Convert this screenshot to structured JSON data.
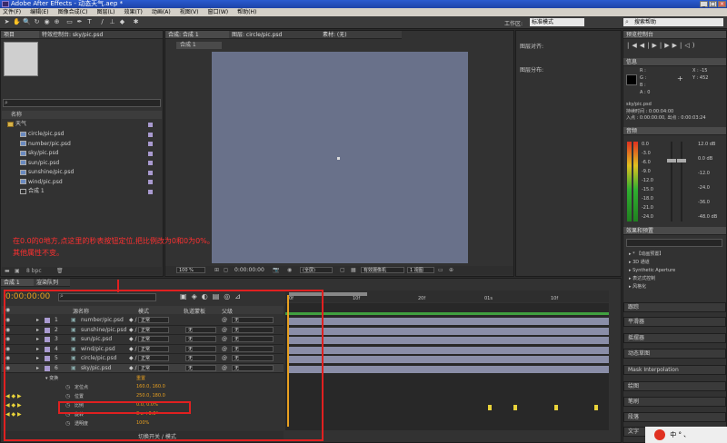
{
  "window": {
    "title": "Adobe After Effects - 动态天气.aep *"
  },
  "menu": [
    "文件(F)",
    "编辑(E)",
    "图像合成(C)",
    "图层(L)",
    "效果(T)",
    "动画(A)",
    "视图(V)",
    "窗口(W)",
    "帮助(H)"
  ],
  "toolbar": {
    "workspace_label": "工作区:",
    "workspace_value": "标准模式",
    "search_placeholder": "搜索帮助"
  },
  "project": {
    "tab": "项目",
    "effects_tab": "特效控制台: sky/pic.psd",
    "search": "",
    "col_name": "名称",
    "folder": "天气",
    "files": [
      "circle/pic.psd",
      "number/pic.psd",
      "sky/pic.psd",
      "sun/pic.psd",
      "sunshine/pic.psd",
      "wind/pic.psd"
    ],
    "comp": "合成 1",
    "bpc": "8 bpc"
  },
  "composition": {
    "tab": "合成: 合成 1",
    "layer_tab": "图层: circle/pic.psd",
    "footage_tab": "素材: (无)",
    "subtab": "合成 1",
    "zoom": "100 %",
    "time": "0:00:00:00",
    "quality": "(全屏)",
    "camera": "有效摄像机",
    "views": "1 视图"
  },
  "info_panel": {
    "align_title": "图层对齐:",
    "distribute_title": "图层分布:"
  },
  "preview": {
    "tab": "预览控制台"
  },
  "info": {
    "tab": "信息",
    "r": "R :",
    "g": "G :",
    "b": "B :",
    "a": "A : 0",
    "x": "X : -15",
    "y": "Y : 452",
    "name": "sky/pic.psd",
    "duration": "持续时间 : 0:00:04:00",
    "in": "入点 : 0:00:00:00, 出点 : 0:00:03:24"
  },
  "audio": {
    "tab": "音频",
    "left_scale": [
      "0.0",
      "-3.0",
      "-6.0",
      "-9.0",
      "-12.0",
      "-15.0",
      "-18.0",
      "-21.0",
      "-24.0"
    ],
    "right_scale": [
      "12.0 dB",
      "0.0 dB",
      "-12.0",
      "-24.0",
      "-36.0",
      "-48.0 dB"
    ]
  },
  "effects": {
    "tab": "效果和预置",
    "search": "",
    "items": [
      "* 【动画预置】",
      "3D 通道",
      "Synthetic Aperture",
      "表达式控制",
      "风格化"
    ]
  },
  "right_tabs": [
    "跟踪",
    "平滑器",
    "摇摆器",
    "动态草图",
    "Mask Interpolation",
    "绘图",
    "笔刷",
    "段落",
    "文字"
  ],
  "annotation": {
    "line1": "在0.0的0地方,点这里的秒表按钮定位,把比例改为0和0为0%。",
    "line2": "其他属性不变。"
  },
  "timeline": {
    "tab": "合成 1",
    "render_tab": "渲染队列",
    "time": "0:00:00:00",
    "cols": {
      "name": "源名称",
      "mode": "模式",
      "trkmat": "轨道蒙板",
      "parent": "父级"
    },
    "ruler": [
      "0f",
      "10f",
      "20f",
      "01s",
      "10f"
    ],
    "layers": [
      {
        "num": "1",
        "name": "number/pic.psd",
        "mode": "正常",
        "trk": "",
        "parent": "无",
        "color": "#a99ad0"
      },
      {
        "num": "2",
        "name": "sunshine/pic.psd",
        "mode": "正常",
        "trk": "无",
        "parent": "无",
        "color": "#a99ad0"
      },
      {
        "num": "3",
        "name": "sun/pic.psd",
        "mode": "正常",
        "trk": "无",
        "parent": "无",
        "color": "#a99ad0"
      },
      {
        "num": "4",
        "name": "wind/pic.psd",
        "mode": "正常",
        "trk": "无",
        "parent": "无",
        "color": "#a99ad0"
      },
      {
        "num": "5",
        "name": "circle/pic.psd",
        "mode": "正常",
        "trk": "无",
        "parent": "无",
        "color": "#a99ad0"
      },
      {
        "num": "6",
        "name": "sky/pic.psd",
        "mode": "正常",
        "trk": "无",
        "parent": "无",
        "color": "#a99ad0"
      }
    ],
    "transform": "变换",
    "reset": "重置",
    "props": [
      {
        "name": "定位点",
        "value": "160.0, 160.0"
      },
      {
        "name": "位置",
        "value": "250.0, 180.0"
      },
      {
        "name": "比例",
        "value": "0.0, 0.0%"
      },
      {
        "name": "旋转",
        "value": "0 x +0.0°"
      },
      {
        "name": "透明度",
        "value": "100%"
      }
    ],
    "switch_label": "切换开关 / 模式"
  },
  "taskbar": {
    "text": "中 ° 、"
  }
}
